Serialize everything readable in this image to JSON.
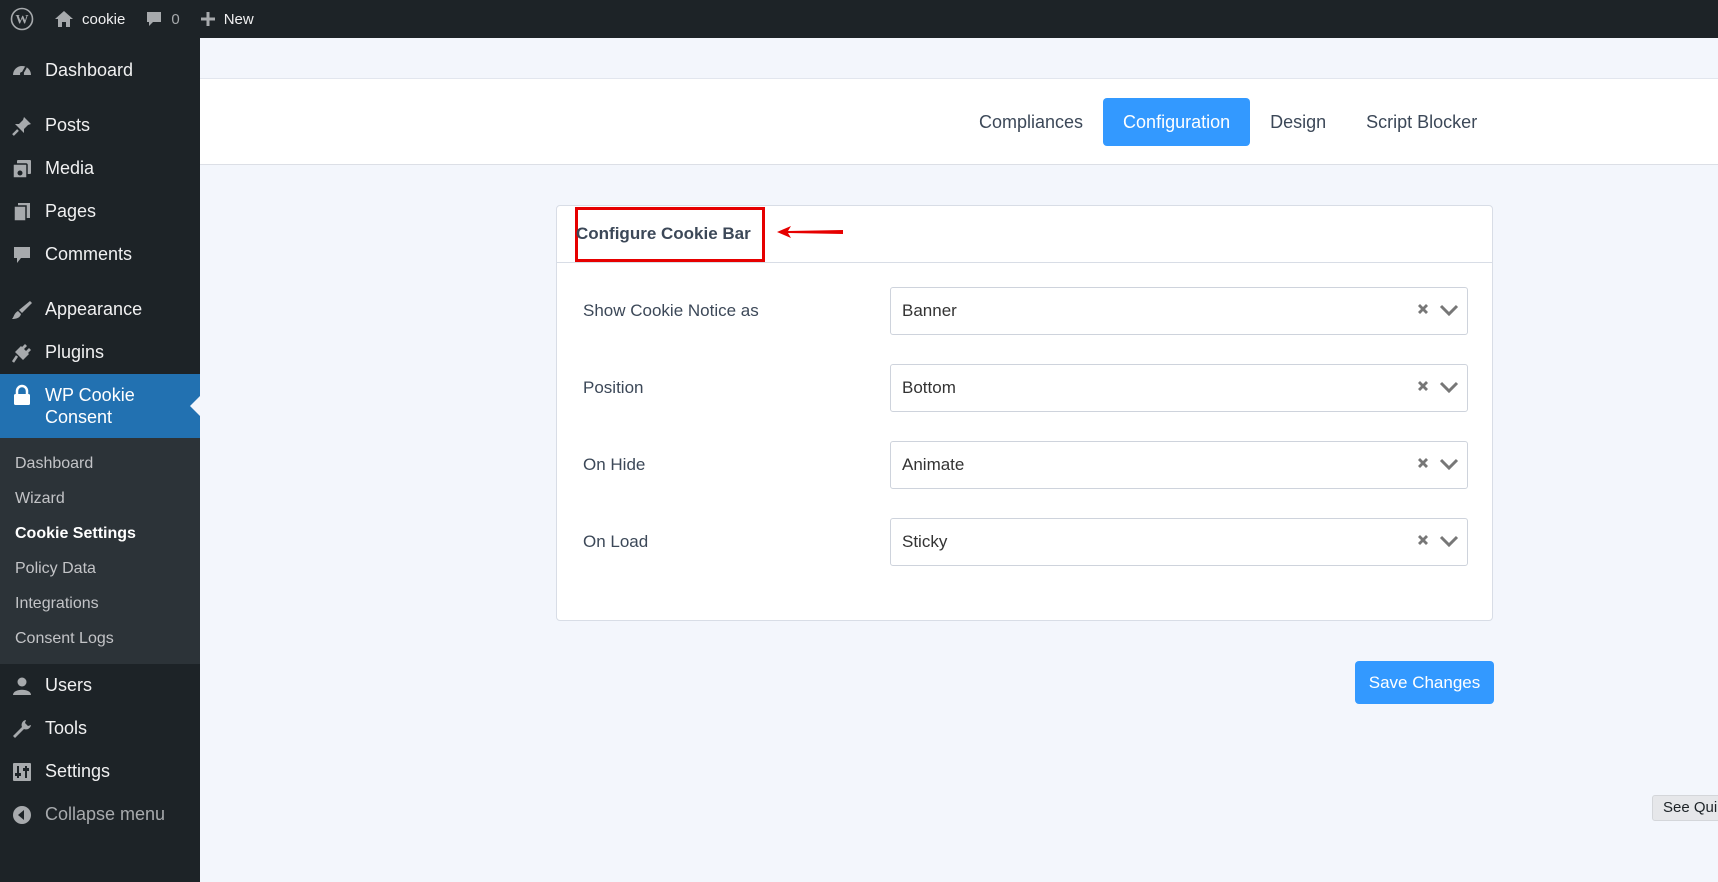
{
  "adminbar": {
    "site_name": "cookie",
    "comments_count": "0",
    "new_label": "New"
  },
  "sidebar": {
    "items": [
      {
        "label": "Dashboard",
        "icon": "dashboard-icon"
      },
      {
        "label": "Posts",
        "icon": "pin-icon"
      },
      {
        "label": "Media",
        "icon": "media-icon"
      },
      {
        "label": "Pages",
        "icon": "pages-icon"
      },
      {
        "label": "Comments",
        "icon": "comment-icon"
      },
      {
        "label": "Appearance",
        "icon": "brush-icon"
      },
      {
        "label": "Plugins",
        "icon": "plug-icon"
      },
      {
        "label": "WP Cookie Consent",
        "icon": "lock-icon"
      },
      {
        "label": "Users",
        "icon": "user-icon"
      },
      {
        "label": "Tools",
        "icon": "wrench-icon"
      },
      {
        "label": "Settings",
        "icon": "settings-icon"
      },
      {
        "label": "Collapse menu",
        "icon": "collapse-icon"
      }
    ],
    "submenu": [
      "Dashboard",
      "Wizard",
      "Cookie Settings",
      "Policy Data",
      "Integrations",
      "Consent Logs"
    ]
  },
  "tabs": [
    "Compliances",
    "Configuration",
    "Design",
    "Script Blocker"
  ],
  "card": {
    "title": "Configure Cookie Bar",
    "rows": [
      {
        "label": "Show Cookie Notice as",
        "value": "Banner"
      },
      {
        "label": "Position",
        "value": "Bottom"
      },
      {
        "label": "On Hide",
        "value": "Animate"
      },
      {
        "label": "On Load",
        "value": "Sticky"
      }
    ]
  },
  "save_label": "Save Changes",
  "quick_tab_label": "See Qui",
  "colors": {
    "accent": "#3399ff",
    "wp_blue": "#2271b1",
    "admin_dark": "#1d2327",
    "highlight_red": "#e60000"
  }
}
